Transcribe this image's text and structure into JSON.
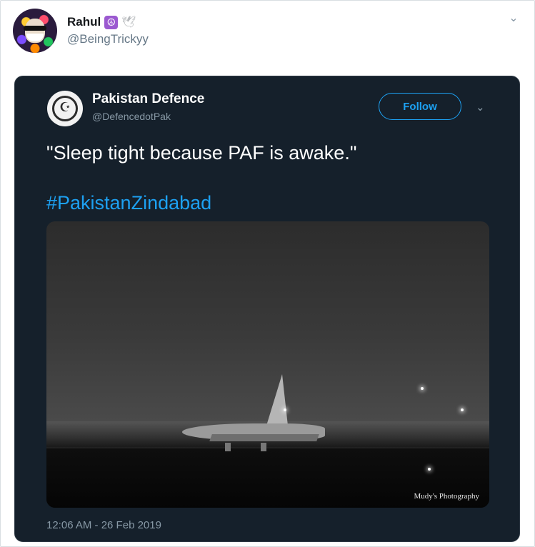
{
  "retweeter": {
    "name": "Rahul",
    "peace_emoji": "☮",
    "dove_emoji": "🕊",
    "handle": "@BeingTrickyy",
    "avatar_icon": "avatar-icon",
    "menu_icon": "chevron-down-icon"
  },
  "embedded_tweet": {
    "author_name": "Pakistan Defence",
    "author_handle": "@DefencedotPak",
    "follow_label": "Follow",
    "text": "\"Sleep tight because PAF is awake.\"",
    "hashtag": "#PakistanZindabad",
    "media": {
      "description_icon": "fighter-jet-photo",
      "watermark": "Mudy's Photography"
    },
    "timestamp": "12:06 AM - 26 Feb 2019"
  },
  "colors": {
    "accent": "#1da1f2",
    "embed_background": "#15202b",
    "muted_text": "#8899a6"
  }
}
